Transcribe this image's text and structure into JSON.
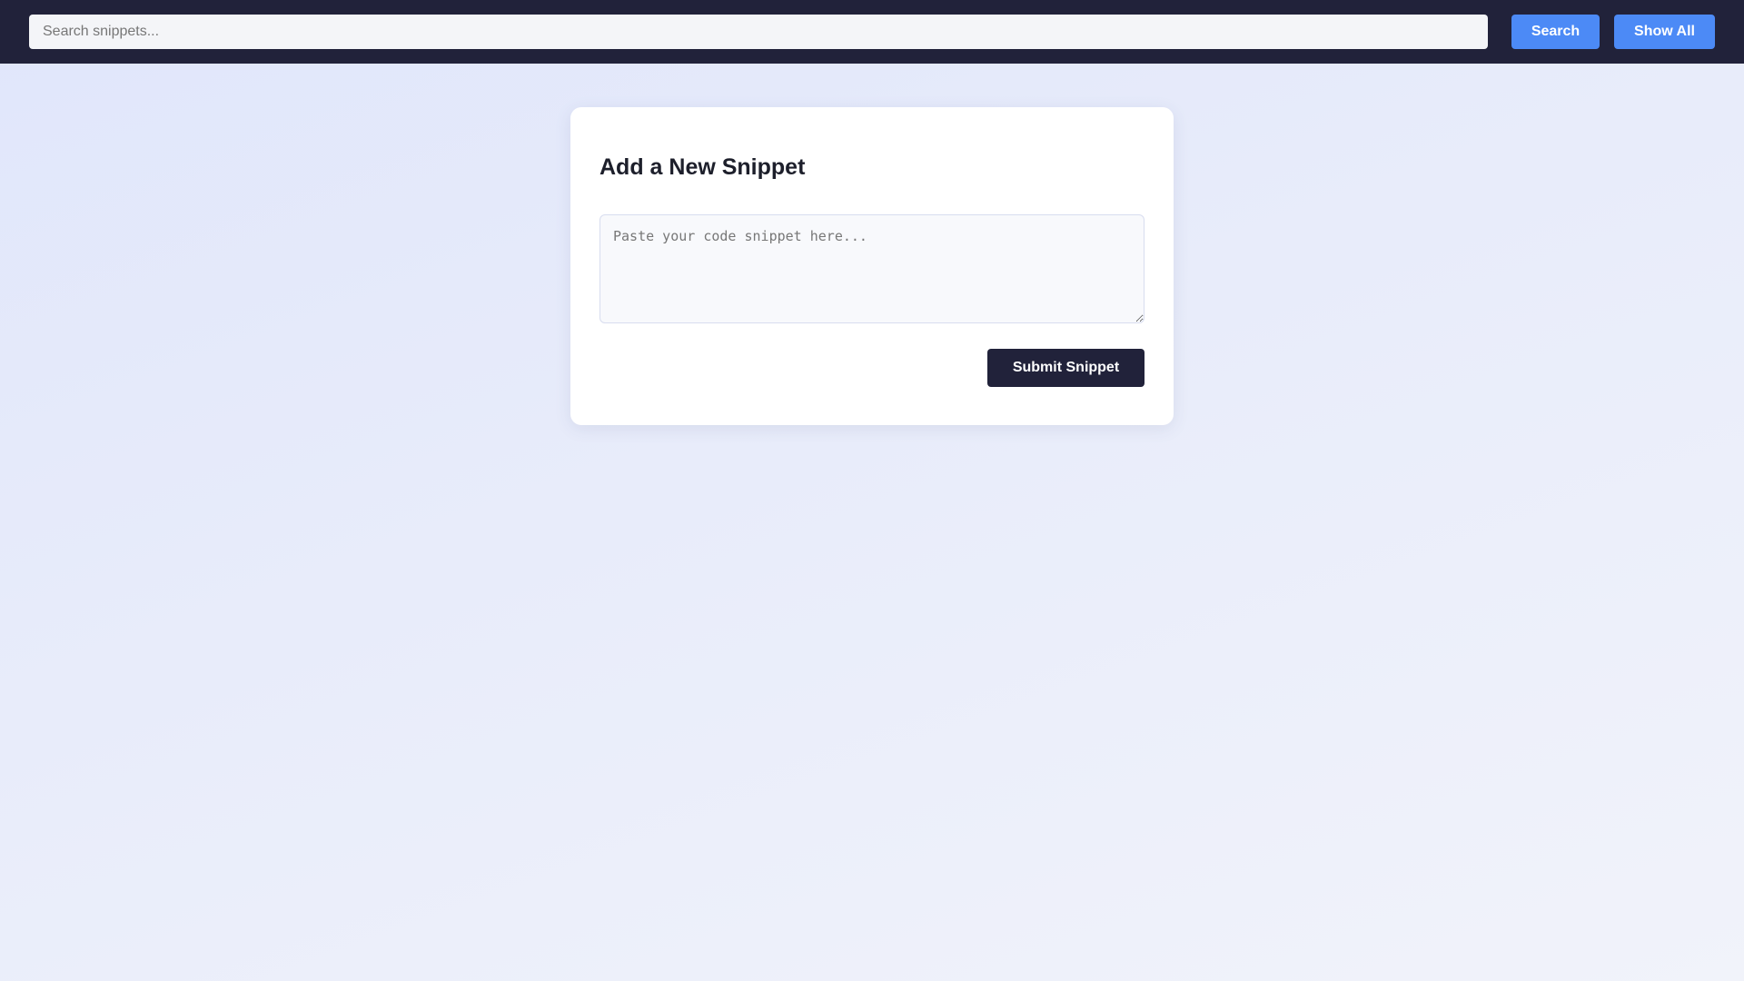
{
  "header": {
    "search_placeholder": "Search snippets...",
    "search_value": "",
    "search_button_label": "Search",
    "show_all_button_label": "Show All"
  },
  "card": {
    "title": "Add a New Snippet",
    "textarea_placeholder": "Paste your code snippet here...",
    "textarea_value": "",
    "submit_button_label": "Submit Snippet"
  },
  "colors": {
    "header_background": "#21223a",
    "accent_blue": "#4c8af6",
    "submit_background": "#21223a",
    "card_background": "#ffffff"
  }
}
